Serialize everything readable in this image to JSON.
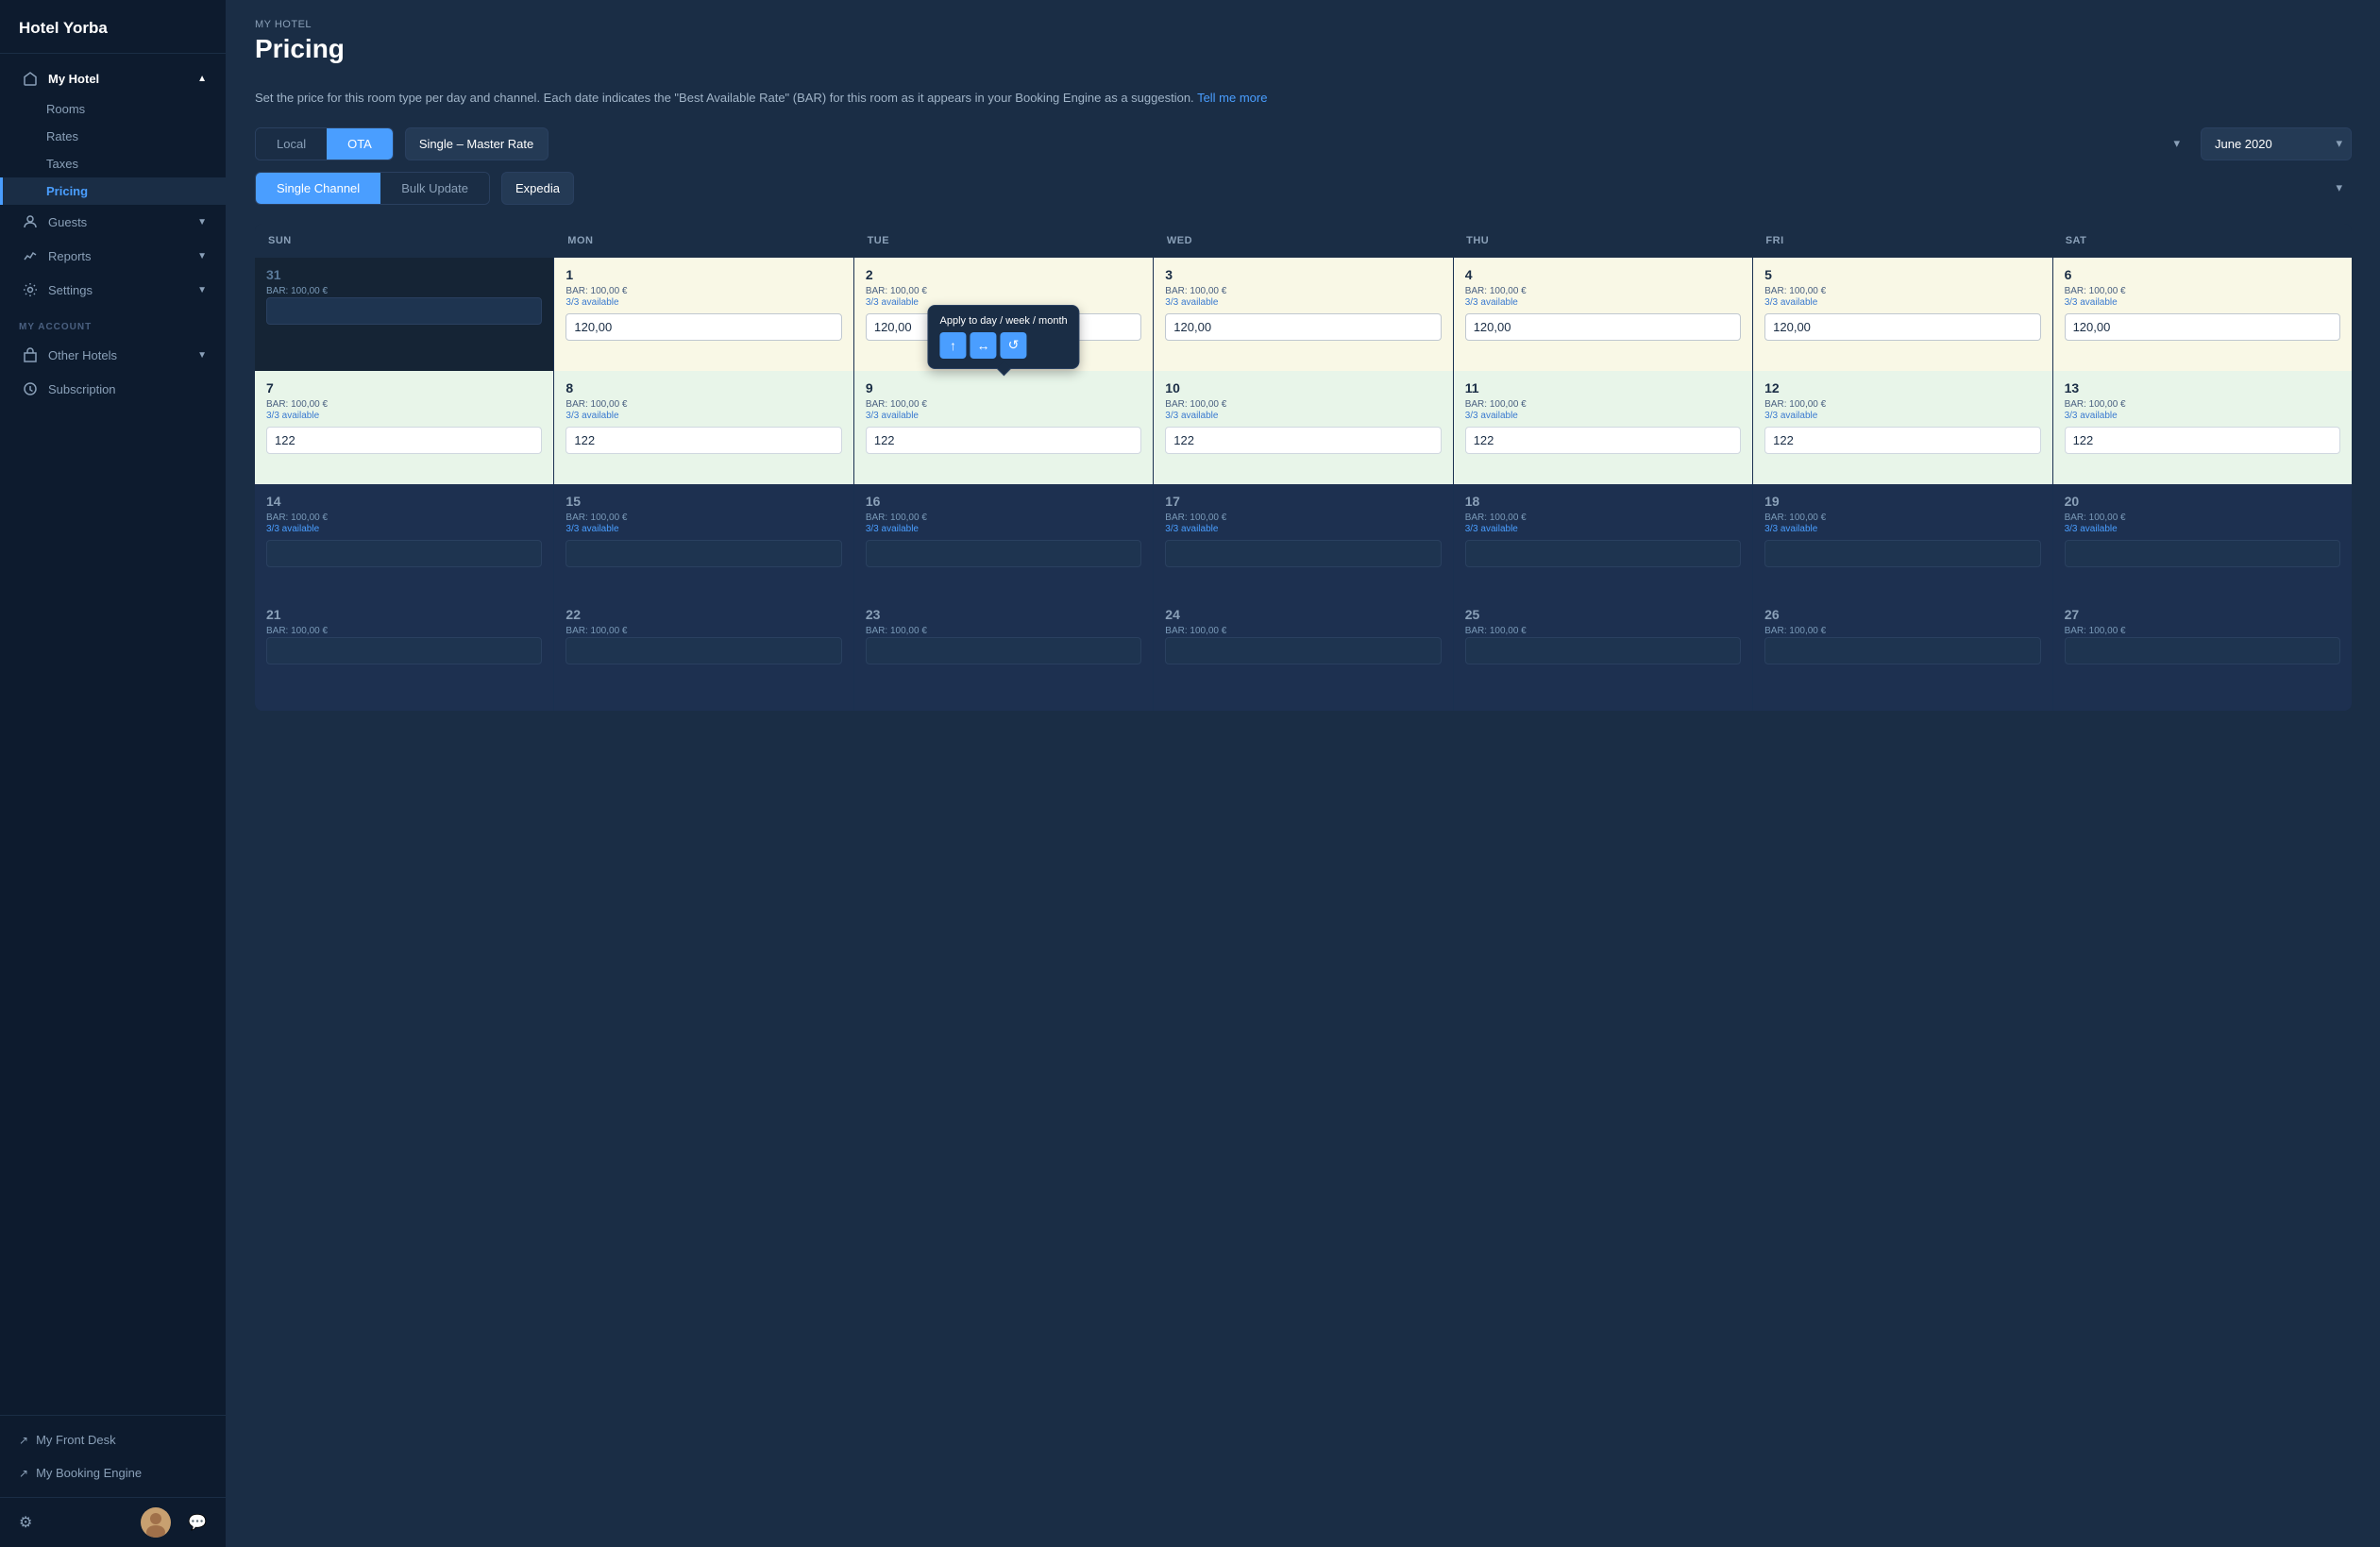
{
  "sidebar": {
    "logo": "Hotel Yorba",
    "nav": {
      "my_hotel_label": "My Hotel",
      "my_hotel_items": [
        "Rooms",
        "Rates",
        "Taxes",
        "Pricing"
      ],
      "guests_label": "Guests",
      "reports_label": "Reports",
      "settings_label": "Settings",
      "my_account_label": "MY ACCOUNT",
      "other_hotels_label": "Other Hotels",
      "subscription_label": "Subscription"
    },
    "bottom_links": [
      "My Front Desk",
      "My Booking Engine"
    ]
  },
  "page": {
    "breadcrumb": "MY HOTEL",
    "title": "Pricing",
    "description": "Set the price for this room type per day and channel. Each date indicates the \"Best Available Rate\" (BAR) for this room as it appears in your Booking Engine as a suggestion.",
    "tell_me_more": "Tell me more",
    "tab_local": "Local",
    "tab_ota": "OTA",
    "rate_select_value": "Single – Master Rate",
    "month_select_value": "June 2020",
    "tab_single": "Single Channel",
    "tab_bulk": "Bulk Update",
    "channel_select_value": "Expedia"
  },
  "calendar": {
    "headers": [
      "SUN",
      "MON",
      "TUE",
      "WED",
      "THU",
      "FRI",
      "SAT"
    ],
    "week1": [
      {
        "day": "31",
        "bar": "BAR: 100,00 €",
        "avail": "",
        "value": "",
        "style": "dim"
      },
      {
        "day": "1",
        "bar": "BAR: 100,00 €",
        "avail": "3/3 available",
        "value": "120,00",
        "style": "highlighted"
      },
      {
        "day": "2",
        "bar": "BAR: 100,00 €",
        "avail": "3/3 available",
        "value": "120,00",
        "style": "highlighted"
      },
      {
        "day": "3",
        "bar": "BAR: 100,00 €",
        "avail": "3/3 available",
        "value": "120,00",
        "style": "highlighted"
      },
      {
        "day": "4",
        "bar": "BAR: 100,00 €",
        "avail": "3/3 available",
        "value": "120,00",
        "style": "highlighted"
      },
      {
        "day": "5",
        "bar": "BAR: 100,00 €",
        "avail": "3/3 available",
        "value": "120,00",
        "style": "highlighted"
      },
      {
        "day": "6",
        "bar": "BAR: 100,00 €",
        "avail": "3/3 available",
        "value": "120,00",
        "style": "highlighted"
      }
    ],
    "week2": [
      {
        "day": "7",
        "bar": "BAR: 100,00 €",
        "avail": "3/3 available",
        "value": "122",
        "style": "light-green"
      },
      {
        "day": "8",
        "bar": "BAR: 100,00 €",
        "avail": "3/3 available",
        "value": "122",
        "style": "light-green"
      },
      {
        "day": "9",
        "bar": "BAR: 100,00 €",
        "avail": "3/3 available",
        "value": "122",
        "style": "light-green",
        "tooltip": true
      },
      {
        "day": "10",
        "bar": "BAR: 100,00 €",
        "avail": "3/3 available",
        "value": "122",
        "style": "light-green"
      },
      {
        "day": "11",
        "bar": "BAR: 100,00 €",
        "avail": "3/3 available",
        "value": "122",
        "style": "light-green"
      },
      {
        "day": "12",
        "bar": "BAR: 100,00 €",
        "avail": "3/3 available",
        "value": "122",
        "style": "light-green"
      },
      {
        "day": "13",
        "bar": "BAR: 100,00 €",
        "avail": "3/3 available",
        "value": "122",
        "style": "light-green"
      }
    ],
    "week3": [
      {
        "day": "14",
        "bar": "BAR: 100,00 €",
        "avail": "3/3 available",
        "value": "",
        "style": "normal"
      },
      {
        "day": "15",
        "bar": "BAR: 100,00 €",
        "avail": "3/3 available",
        "value": "",
        "style": "normal"
      },
      {
        "day": "16",
        "bar": "BAR: 100,00 €",
        "avail": "3/3 available",
        "value": "",
        "style": "normal"
      },
      {
        "day": "17",
        "bar": "BAR: 100,00 €",
        "avail": "3/3 available",
        "value": "",
        "style": "normal"
      },
      {
        "day": "18",
        "bar": "BAR: 100,00 €",
        "avail": "3/3 available",
        "value": "",
        "style": "normal"
      },
      {
        "day": "19",
        "bar": "BAR: 100,00 €",
        "avail": "3/3 available",
        "value": "",
        "style": "normal"
      },
      {
        "day": "20",
        "bar": "BAR: 100,00 €",
        "avail": "3/3 available",
        "value": "",
        "style": "normal"
      }
    ],
    "week4": [
      {
        "day": "21",
        "bar": "BAR: 100,00 €",
        "avail": "",
        "value": "",
        "style": "normal"
      },
      {
        "day": "22",
        "bar": "BAR: 100,00 €",
        "avail": "",
        "value": "",
        "style": "normal"
      },
      {
        "day": "23",
        "bar": "BAR: 100,00 €",
        "avail": "",
        "value": "",
        "style": "normal"
      },
      {
        "day": "24",
        "bar": "BAR: 100,00 €",
        "avail": "",
        "value": "",
        "style": "normal"
      },
      {
        "day": "25",
        "bar": "BAR: 100,00 €",
        "avail": "",
        "value": "",
        "style": "normal"
      },
      {
        "day": "26",
        "bar": "BAR: 100,00 €",
        "avail": "",
        "value": "",
        "style": "normal"
      },
      {
        "day": "27",
        "bar": "BAR: 100,00 €",
        "avail": "",
        "value": "",
        "style": "normal"
      }
    ],
    "tooltip": {
      "title": "Apply to day / week / month",
      "btn_up": "↑",
      "btn_horizontal": "↔",
      "btn_circle": "↺"
    }
  }
}
